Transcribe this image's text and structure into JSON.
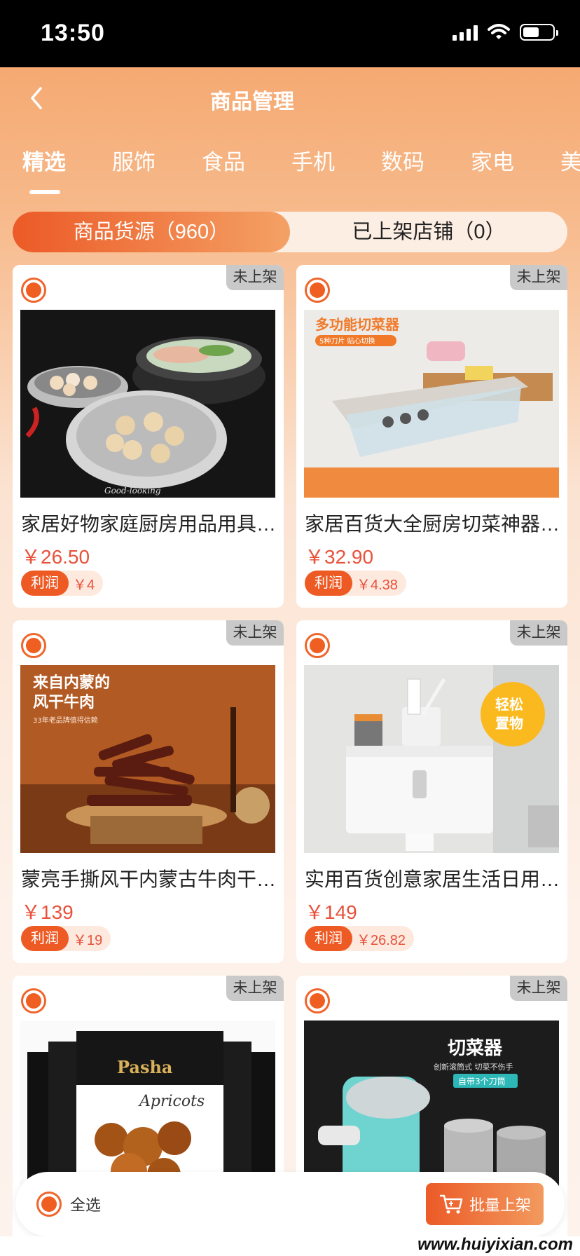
{
  "status_bar": {
    "time": "13:50"
  },
  "header": {
    "title": "商品管理"
  },
  "category_tabs": [
    "精选",
    "服饰",
    "食品",
    "手机",
    "数码",
    "家电",
    "美"
  ],
  "segments": {
    "source": "商品货源（960）",
    "listed": "已上架店铺（0）"
  },
  "products": [
    {
      "badge": "未上架",
      "title": "家居好物家庭厨房用品用具…",
      "price": "￥26.50",
      "profit_label": "利润",
      "profit": "￥4",
      "image": "steamer-rack"
    },
    {
      "badge": "未上架",
      "title": "家居百货大全厨房切菜神器…",
      "price": "￥32.90",
      "profit_label": "利润",
      "profit": "￥4.38",
      "image": "vegetable-slicer",
      "image_text": {
        "headline": "多功能切菜器",
        "sub": "5种刀片 贴心切换"
      }
    },
    {
      "badge": "未上架",
      "title": "蒙亮手撕风干内蒙古牛肉干…",
      "price": "￥139",
      "profit_label": "利润",
      "profit": "￥19",
      "image": "beef-jerky",
      "image_text": {
        "headline1": "来自内蒙的",
        "headline2": "风干牛肉",
        "sub": "33年老品牌值得信赖"
      }
    },
    {
      "badge": "未上架",
      "title": "实用百货创意家居生活日用…",
      "price": "￥149",
      "profit_label": "利润",
      "profit": "￥26.82",
      "image": "tissue-box",
      "image_text": {
        "bubble1": "轻松",
        "bubble2": "置物"
      }
    },
    {
      "badge": "未上架",
      "image": "dried-apricots",
      "image_text": {
        "brand": "Pasha",
        "product": "Apricots"
      }
    },
    {
      "badge": "未上架",
      "image": "drum-slicer",
      "image_text": {
        "headline": "切菜器",
        "sub": "创新滚筒式 切菜不伤手",
        "tag": "自带3个刀筒"
      }
    }
  ],
  "bottom_bar": {
    "select_all": "全选",
    "batch_button": "批量上架"
  },
  "watermark": "www.huiyixian.com",
  "colors": {
    "accent": "#ef5f22",
    "price": "#e8513a",
    "badge_bg": "#c9c9c9"
  }
}
